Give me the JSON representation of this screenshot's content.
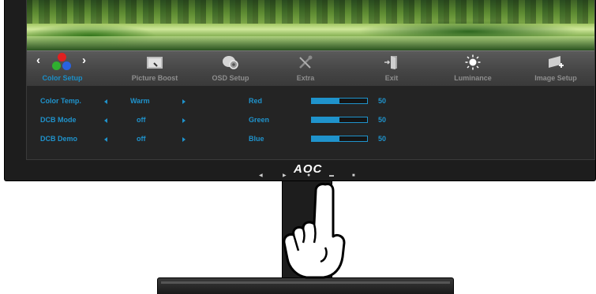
{
  "osd": {
    "tabs": [
      {
        "label": "Color Setup",
        "icon": "rgb-dots-icon",
        "active": true
      },
      {
        "label": "Picture Boost",
        "icon": "picture-boost-icon",
        "active": false
      },
      {
        "label": "OSD Setup",
        "icon": "osd-setup-icon",
        "active": false
      },
      {
        "label": "Extra",
        "icon": "tools-icon",
        "active": false
      },
      {
        "label": "Exit",
        "icon": "exit-door-icon",
        "active": false
      },
      {
        "label": "Luminance",
        "icon": "sun-icon",
        "active": false
      },
      {
        "label": "Image Setup",
        "icon": "image-setup-icon",
        "active": false
      }
    ],
    "settings": [
      {
        "label": "Color Temp.",
        "value": "Warm"
      },
      {
        "label": "DCB Mode",
        "value": "off"
      },
      {
        "label": "DCB Demo",
        "value": "off"
      }
    ],
    "sliders": [
      {
        "label": "Red",
        "value": "50",
        "level": 0.5
      },
      {
        "label": "Green",
        "value": "50",
        "level": 0.5
      },
      {
        "label": "Blue",
        "value": "50",
        "level": 0.5
      }
    ],
    "colors": {
      "accent": "#1f93cc",
      "inactive_label": "#8e8e8e",
      "panel_bg": "#242424"
    }
  },
  "monitor": {
    "brand": "AOC",
    "front_buttons": [
      "left-arrow-button",
      "right-arrow-button",
      "power-button",
      "menu-button",
      "source-button"
    ]
  }
}
